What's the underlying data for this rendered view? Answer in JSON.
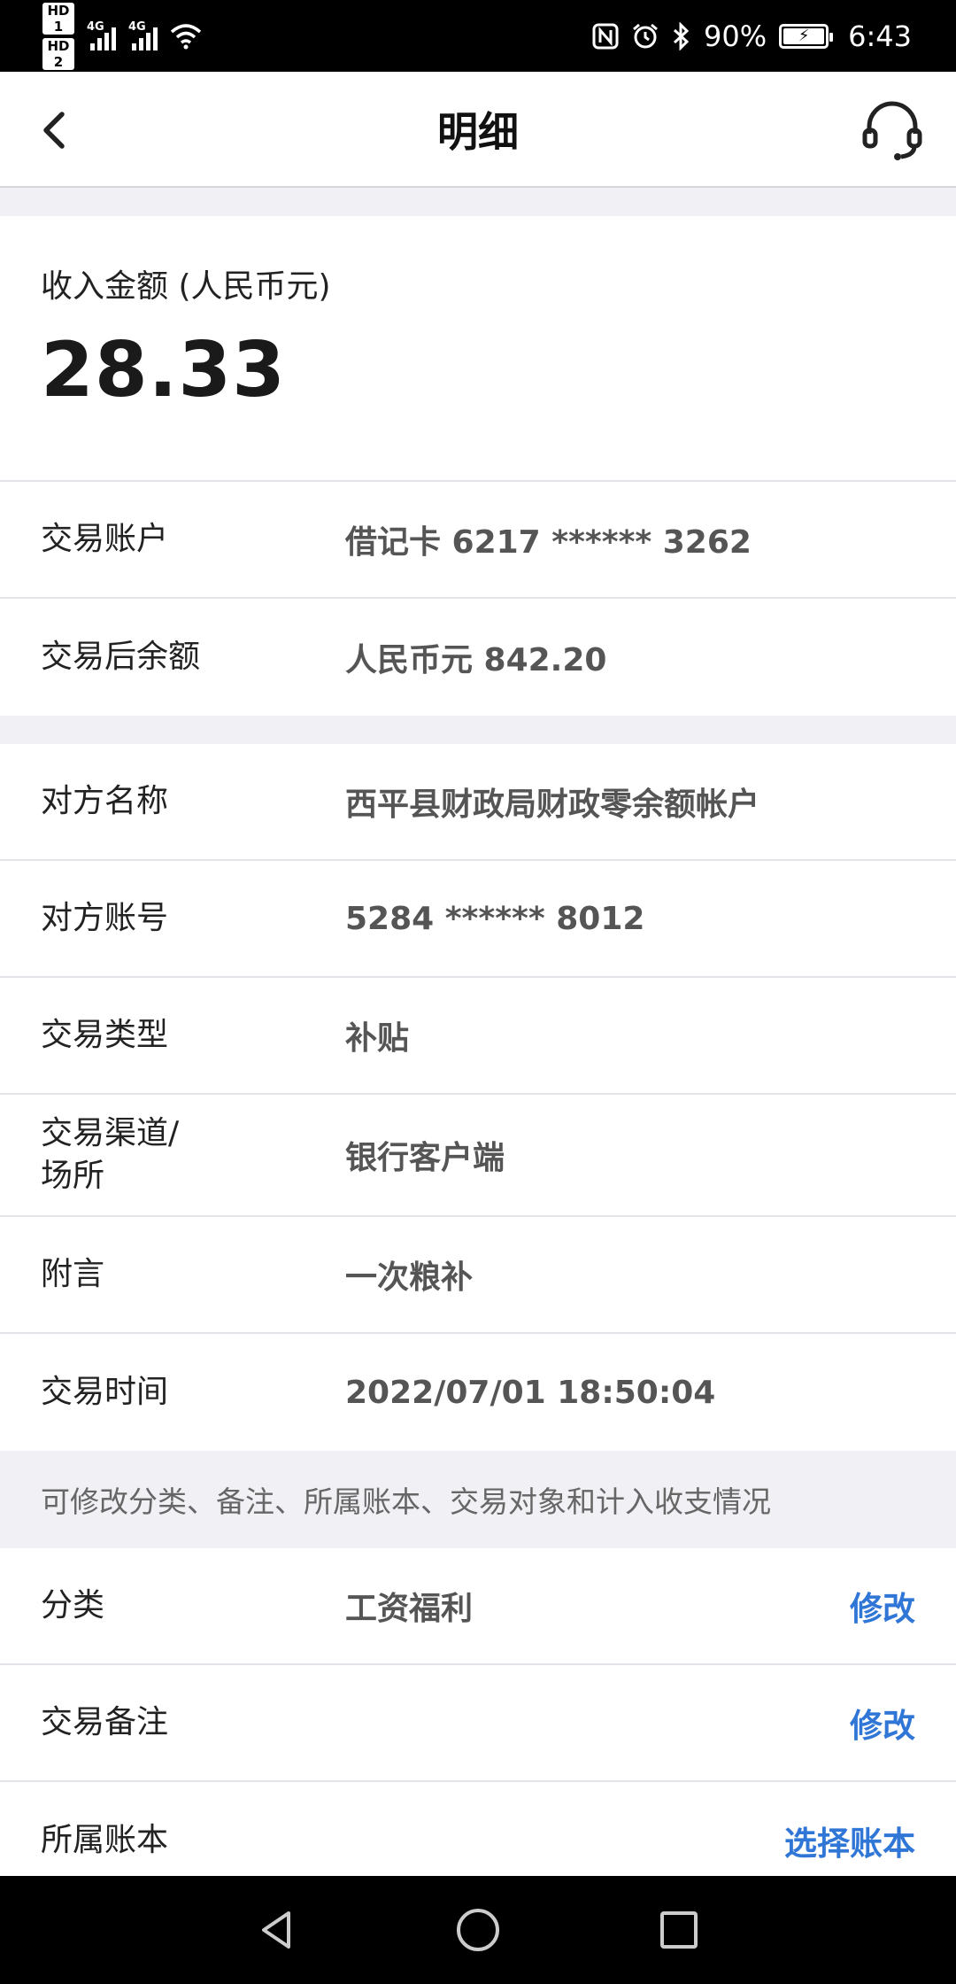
{
  "status_bar": {
    "sim1": "HD 1",
    "sim2": "HD 2",
    "signal1_label": "4G",
    "signal2_label": "4G",
    "battery_percent": "90%",
    "time": "6:43",
    "icons": [
      "nfc-icon",
      "alarm-icon",
      "bluetooth-icon",
      "wifi-icon",
      "battery-icon"
    ]
  },
  "header": {
    "title": "明细",
    "back_icon": "chevron-left-icon",
    "service_icon": "headset-icon"
  },
  "amount": {
    "label": "收入金额 (人民币元)",
    "value": "28.33"
  },
  "account_section": [
    {
      "key": "交易账户",
      "value": "借记卡 6217 ****** 3262"
    },
    {
      "key": "交易后余额",
      "value": "人民币元 842.20"
    }
  ],
  "detail_section": {
    "counterparty_name": {
      "key": "对方名称",
      "value": "西平县财政局财政零余额帐户"
    },
    "counterparty_account": {
      "key": "对方账号",
      "value": "5284 ****** 8012"
    },
    "type": {
      "key": "交易类型",
      "value": "补贴"
    },
    "channel": {
      "key_line1": "交易渠道/",
      "key_line2": "场所",
      "value": "银行客户端"
    },
    "remark": {
      "key": "附言",
      "value": "一次粮补"
    },
    "time": {
      "key": "交易时间",
      "value": "2022/07/01 18:50:04"
    }
  },
  "edit_note": "可修改分类、备注、所属账本、交易对象和计入收支情况",
  "editable_section": {
    "category": {
      "key": "分类",
      "value": "工资福利",
      "action": "修改"
    },
    "memo": {
      "key": "交易备注",
      "value": "",
      "action": "修改"
    },
    "ledger": {
      "key": "所属账本",
      "value": "",
      "action": "选择账本"
    }
  },
  "colors": {
    "accent": "#2f76d6",
    "background_gray": "#f0f0f5",
    "divider": "#e3e3e8"
  },
  "nav_bar": {
    "icons": [
      "back-triangle-icon",
      "home-circle-icon",
      "recents-square-icon"
    ]
  }
}
